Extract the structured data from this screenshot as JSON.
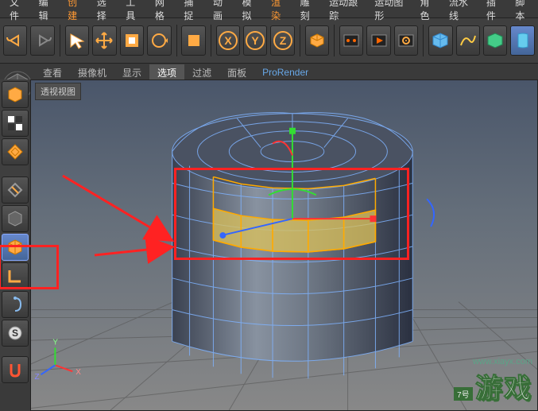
{
  "menu": {
    "items": [
      {
        "label": "文件",
        "hi": false
      },
      {
        "label": "编辑",
        "hi": false
      },
      {
        "label": "创建",
        "hi": true
      },
      {
        "label": "选择",
        "hi": false
      },
      {
        "label": "工具",
        "hi": false
      },
      {
        "label": "网格",
        "hi": false
      },
      {
        "label": "捕捉",
        "hi": false
      },
      {
        "label": "动画",
        "hi": false
      },
      {
        "label": "模拟",
        "hi": false
      },
      {
        "label": "渲染",
        "hi": true
      },
      {
        "label": "雕刻",
        "hi": false
      },
      {
        "label": "运动跟踪",
        "hi": false
      },
      {
        "label": "运动图形",
        "hi": false
      },
      {
        "label": "角色",
        "hi": false
      },
      {
        "label": "流水线",
        "hi": false
      },
      {
        "label": "插件",
        "hi": false
      },
      {
        "label": "脚本",
        "hi": false
      }
    ]
  },
  "vp_menu": {
    "items": [
      {
        "label": "查看"
      },
      {
        "label": "摄像机"
      },
      {
        "label": "显示"
      },
      {
        "label": "选项",
        "sel": true
      },
      {
        "label": "过滤"
      },
      {
        "label": "面板"
      },
      {
        "label": "ProRender",
        "pr": true
      }
    ]
  },
  "viewport": {
    "label": "透视视图"
  },
  "colors": {
    "axis_x": "#ff3333",
    "axis_y": "#33ff33",
    "axis_z": "#3366ff",
    "highlight": "#ff2222",
    "selection": "#ffaa00",
    "selected_face": "#dcc25a"
  },
  "axis_labels": {
    "x": "X",
    "y": "Y",
    "z": "Z"
  },
  "watermark": {
    "url": "www.xiayx.com",
    "brand_small": "7号",
    "brand_big": "游戏"
  }
}
